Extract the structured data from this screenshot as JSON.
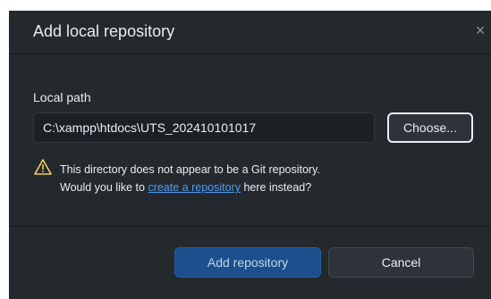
{
  "dialog": {
    "title": "Add local repository",
    "close_glyph": "×"
  },
  "local_path": {
    "label": "Local path",
    "value": "C:\\xampp\\htdocs\\UTS_202410101017",
    "choose_label": "Choose..."
  },
  "warning": {
    "icon": "warning-icon",
    "line1": "This directory does not appear to be a Git repository.",
    "line2_prefix": "Would you like to ",
    "link_text": "create a repository",
    "line2_suffix": " here instead?"
  },
  "footer": {
    "primary_label": "Add repository",
    "secondary_label": "Cancel"
  },
  "colors": {
    "background": "#24292e",
    "warning": "#f2cc60",
    "link": "#4d9cf8",
    "primary_button": "#1c4f8e"
  }
}
